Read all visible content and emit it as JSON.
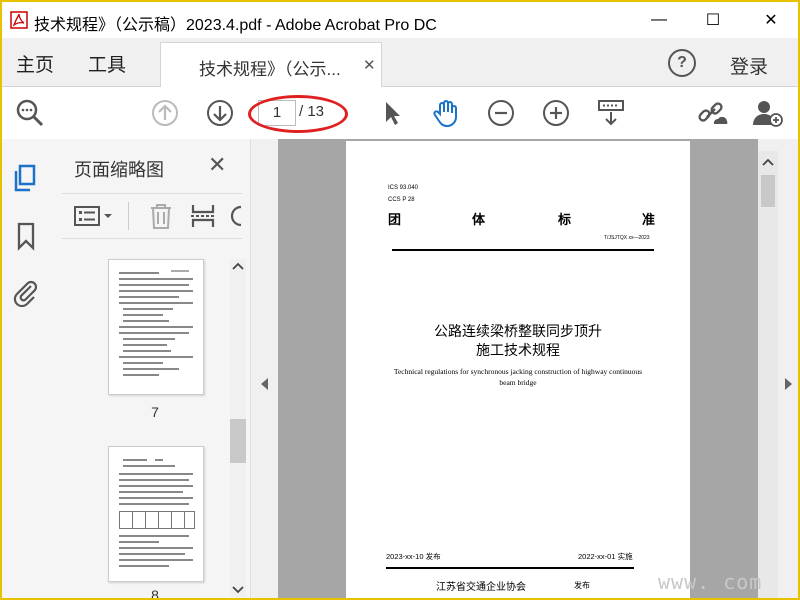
{
  "window": {
    "title": "技术规程》（公示稿）2023.4.pdf - Adobe Acrobat Pro DC",
    "minimize": "—",
    "maximize": "☐",
    "close": "✕"
  },
  "tabs": {
    "home": "主页",
    "tools": "工具",
    "document_tab": "技术规程》（公示...",
    "document_tab_close": "✕",
    "help": "?",
    "login": "登录"
  },
  "toolbar": {
    "current_page": "1",
    "total_pages": "/ 13"
  },
  "thumbnail_panel": {
    "title": "页面缩略图",
    "close": "✕",
    "thumbnails": [
      {
        "page_label": "7"
      },
      {
        "page_label": "8"
      }
    ]
  },
  "document_page": {
    "ics": "ICS 93.040",
    "ccs": "CCS P 28",
    "header_chars": [
      "团",
      "体",
      "标",
      "准"
    ],
    "standard_number": "T/JSJTQX xx—2023",
    "title_line1": "公路连续梁桥整联同步顶升",
    "title_line2": "施工技术规程",
    "english_title_line1": "Technical regulations for synchronous jacking construction of highway continuous",
    "english_title_line2": "beam bridge",
    "publish_date": "2023-xx-10 发布",
    "implement_date": "2022-xx-01 实施",
    "publisher": "江苏省交通企业协会",
    "publish_word": "发布"
  },
  "watermark": "www.      com",
  "colors": {
    "frame_border": "#e8c200",
    "highlight_oval": "#e02020",
    "hand_tool": "#1a73c9",
    "doc_background": "#a6a6a6"
  }
}
